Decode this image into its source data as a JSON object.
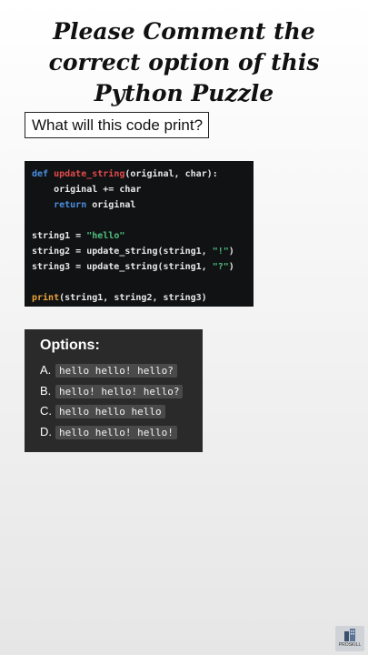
{
  "title": {
    "line1": "Please Comment the",
    "line2": "correct option of this",
    "line3": "Python Puzzle"
  },
  "question": "What will this code print?",
  "code": {
    "line1": {
      "kw": "def",
      "fn": "update_string",
      "rest": "(original, char):"
    },
    "line2": {
      "text": "    original += char"
    },
    "line3": {
      "indent": "    ",
      "kw": "return",
      "rest": " original"
    },
    "line5": {
      "pre": "string1 = ",
      "str": "\"hello\""
    },
    "line6": {
      "pre": "string2 = update_string(string1, ",
      "str": "\"!\"",
      "post": ")"
    },
    "line7": {
      "pre": "string3 = update_string(string1, ",
      "str": "\"?\"",
      "post": ")"
    },
    "line9": {
      "bi": "print",
      "rest": "(string1, string2, string3)"
    }
  },
  "options": {
    "title": "Options:",
    "items": [
      {
        "letter": "A.",
        "value": "hello hello! hello?"
      },
      {
        "letter": "B.",
        "value": "hello! hello! hello?"
      },
      {
        "letter": "C.",
        "value": "hello hello hello"
      },
      {
        "letter": "D.",
        "value": "hello hello! hello!"
      }
    ]
  },
  "logo": {
    "text": "PROSKILL",
    "icon": "building-logo-icon"
  }
}
